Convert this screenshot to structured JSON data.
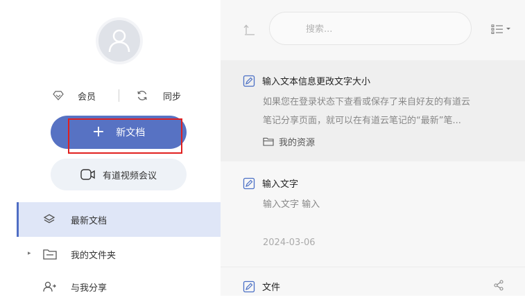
{
  "sidebar": {
    "member_label": "会员",
    "sync_label": "同步",
    "new_doc_label": "新文档",
    "video_meeting_label": "有道视频会议",
    "nav": [
      {
        "label": "最新文档",
        "icon": "layers-icon",
        "active": true
      },
      {
        "label": "我的文件夹",
        "icon": "folder-icon",
        "active": false
      },
      {
        "label": "与我分享",
        "icon": "shared-users-icon",
        "active": false
      }
    ]
  },
  "toolbar": {
    "search_placeholder": "搜索..."
  },
  "notes": [
    {
      "title": "输入文本信息更改文字大小",
      "snippet_line1": "如果您在登录状态下查看或保存了来自好友的有道云",
      "snippet_line2": "笔记分享页面，就可以在有道云笔记的“最新”笔...",
      "folder": "我的资源"
    },
    {
      "title": "输入文字",
      "snippet": "输入文字 输入",
      "date": "2024-03-06"
    },
    {
      "title": "文件"
    }
  ],
  "colors": {
    "accent": "#5772c3",
    "highlight_box": "#e0201f",
    "active_nav_bg": "#dfe6f7"
  }
}
